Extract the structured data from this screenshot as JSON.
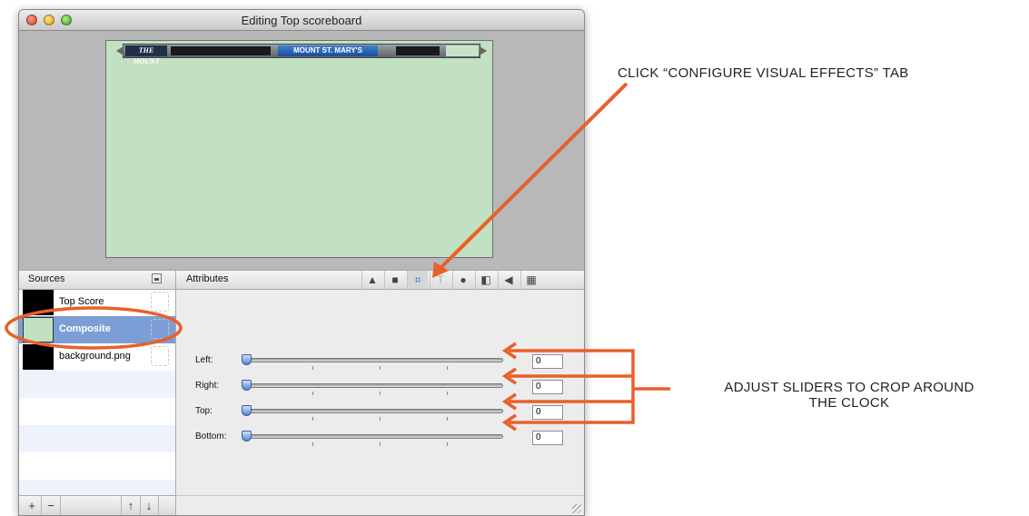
{
  "window": {
    "title": "Editing Top scoreboard"
  },
  "scoreboard": {
    "left_text": "THE MOUNT",
    "center_text": "MOUNT ST. MARY'S"
  },
  "sources": {
    "header": "Sources",
    "items": [
      {
        "name": "Top Score",
        "thumb": "black",
        "selected": false
      },
      {
        "name": "Composite",
        "thumb": "green",
        "selected": true
      },
      {
        "name": "background.png",
        "thumb": "black",
        "selected": false
      }
    ],
    "footer": {
      "add": "+",
      "remove": "−",
      "up": "🡅",
      "down": "🡇"
    }
  },
  "attributes": {
    "header": "Attributes",
    "tabs": [
      {
        "icon": "shapes-icon",
        "glyph": "▲"
      },
      {
        "icon": "folder-icon",
        "glyph": "■"
      },
      {
        "icon": "crop-icon",
        "glyph": "⌗",
        "active": true
      },
      {
        "icon": "text-icon",
        "glyph": "T"
      },
      {
        "icon": "person-icon",
        "glyph": "●"
      },
      {
        "icon": "split-icon",
        "glyph": "◧"
      },
      {
        "icon": "speaker-icon",
        "glyph": "◀"
      },
      {
        "icon": "checker-icon",
        "glyph": "▦"
      }
    ],
    "sliders": [
      {
        "label": "Left:",
        "value": "0"
      },
      {
        "label": "Right:",
        "value": "0"
      },
      {
        "label": "Top:",
        "value": "0"
      },
      {
        "label": "Bottom:",
        "value": "0"
      }
    ]
  },
  "annotations": {
    "tab_note": "CLICK “CONFIGURE VISUAL EFFECTS” TAB",
    "slider_note_line1": "ADJUST SLIDERS TO CROP AROUND",
    "slider_note_line2": "THE CLOCK",
    "color": "#e8602c"
  }
}
